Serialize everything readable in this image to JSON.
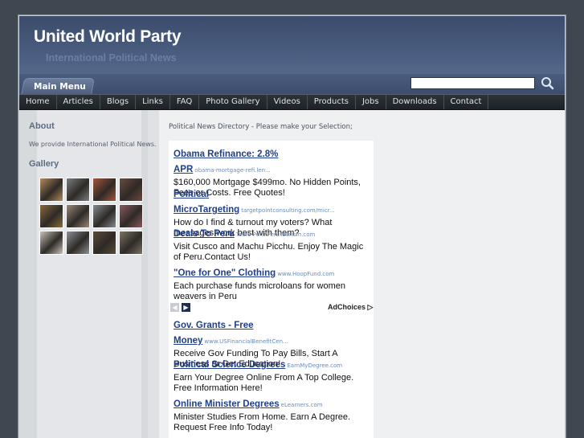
{
  "header": {
    "title": "United World Party",
    "tagline": "International Political News"
  },
  "menu": {
    "main_label": "Main Menu",
    "items": [
      {
        "label": "Home"
      },
      {
        "label": "Articles"
      },
      {
        "label": "Blogs"
      },
      {
        "label": "Links"
      },
      {
        "label": "FAQ"
      },
      {
        "label": "Photo Gallery"
      },
      {
        "label": "Videos"
      },
      {
        "label": "Products"
      },
      {
        "label": "Jobs"
      },
      {
        "label": "Downloads"
      },
      {
        "label": "Contact"
      }
    ]
  },
  "search": {
    "value": "",
    "icon": "search-icon"
  },
  "sidebar": {
    "about_heading": "About",
    "about_text": "We provide International Political News.",
    "gallery_heading": "Gallery",
    "thumb_colors": [
      "#b48a5c",
      "#7a7d80",
      "#a8553a",
      "#6b4a3d",
      "#8a6a3a",
      "#9a8878",
      "#858a90",
      "#8a5a5e",
      "#c8c2b8",
      "#8c9096",
      "#5a4a38",
      "#7a7462"
    ]
  },
  "content": {
    "intro": "Political News Directory - Please make your Selection;"
  },
  "ads": [
    {
      "title": "Obama Refinance: 2.8% APR",
      "url": "obama-mortgage-refi.len...",
      "desc": "$160,000 Mortgage $499mo. No Hidden Points, Fees or Costs. Free Quotes!"
    },
    {
      "title": "Political MicroTargeting",
      "url": "targetpointconsulting.com/micr...",
      "desc": "How do I find & turnout my voters? What messages work best with them?"
    },
    {
      "title": "Deals To Peru",
      "url": "Tours-Peru.PeruTourism.com",
      "desc": "Visit Cusco and Machu Picchu. Enjoy The Magic of Peru.Contact Us!"
    },
    {
      "title": "\"One for One\" Clothing",
      "url": "www.HoopFund.com",
      "desc": "Each purchase funds microloans for women weavers in Peru"
    },
    {
      "title": "Gov. Grants - Free Money",
      "url": "www.USFinancialBenefitCen...",
      "desc": "Receive Gov Funding To Pay Bills, Start A Business or Get Education!"
    },
    {
      "title": "Political Science Degrees",
      "url": "EarnMyDegree.com",
      "desc": "Earn Your Degree Online From A Top College. Free Information Here!"
    },
    {
      "title": "Online Minister Degrees",
      "url": "eLearners.com",
      "desc": "Minister Studies From Home. Earn A Degree. Request Free Info Today!"
    }
  ],
  "ad_controls": {
    "prev_icon": "chevron-left-icon",
    "next_icon": "chevron-right-icon",
    "adchoices_label": "AdChoices"
  }
}
